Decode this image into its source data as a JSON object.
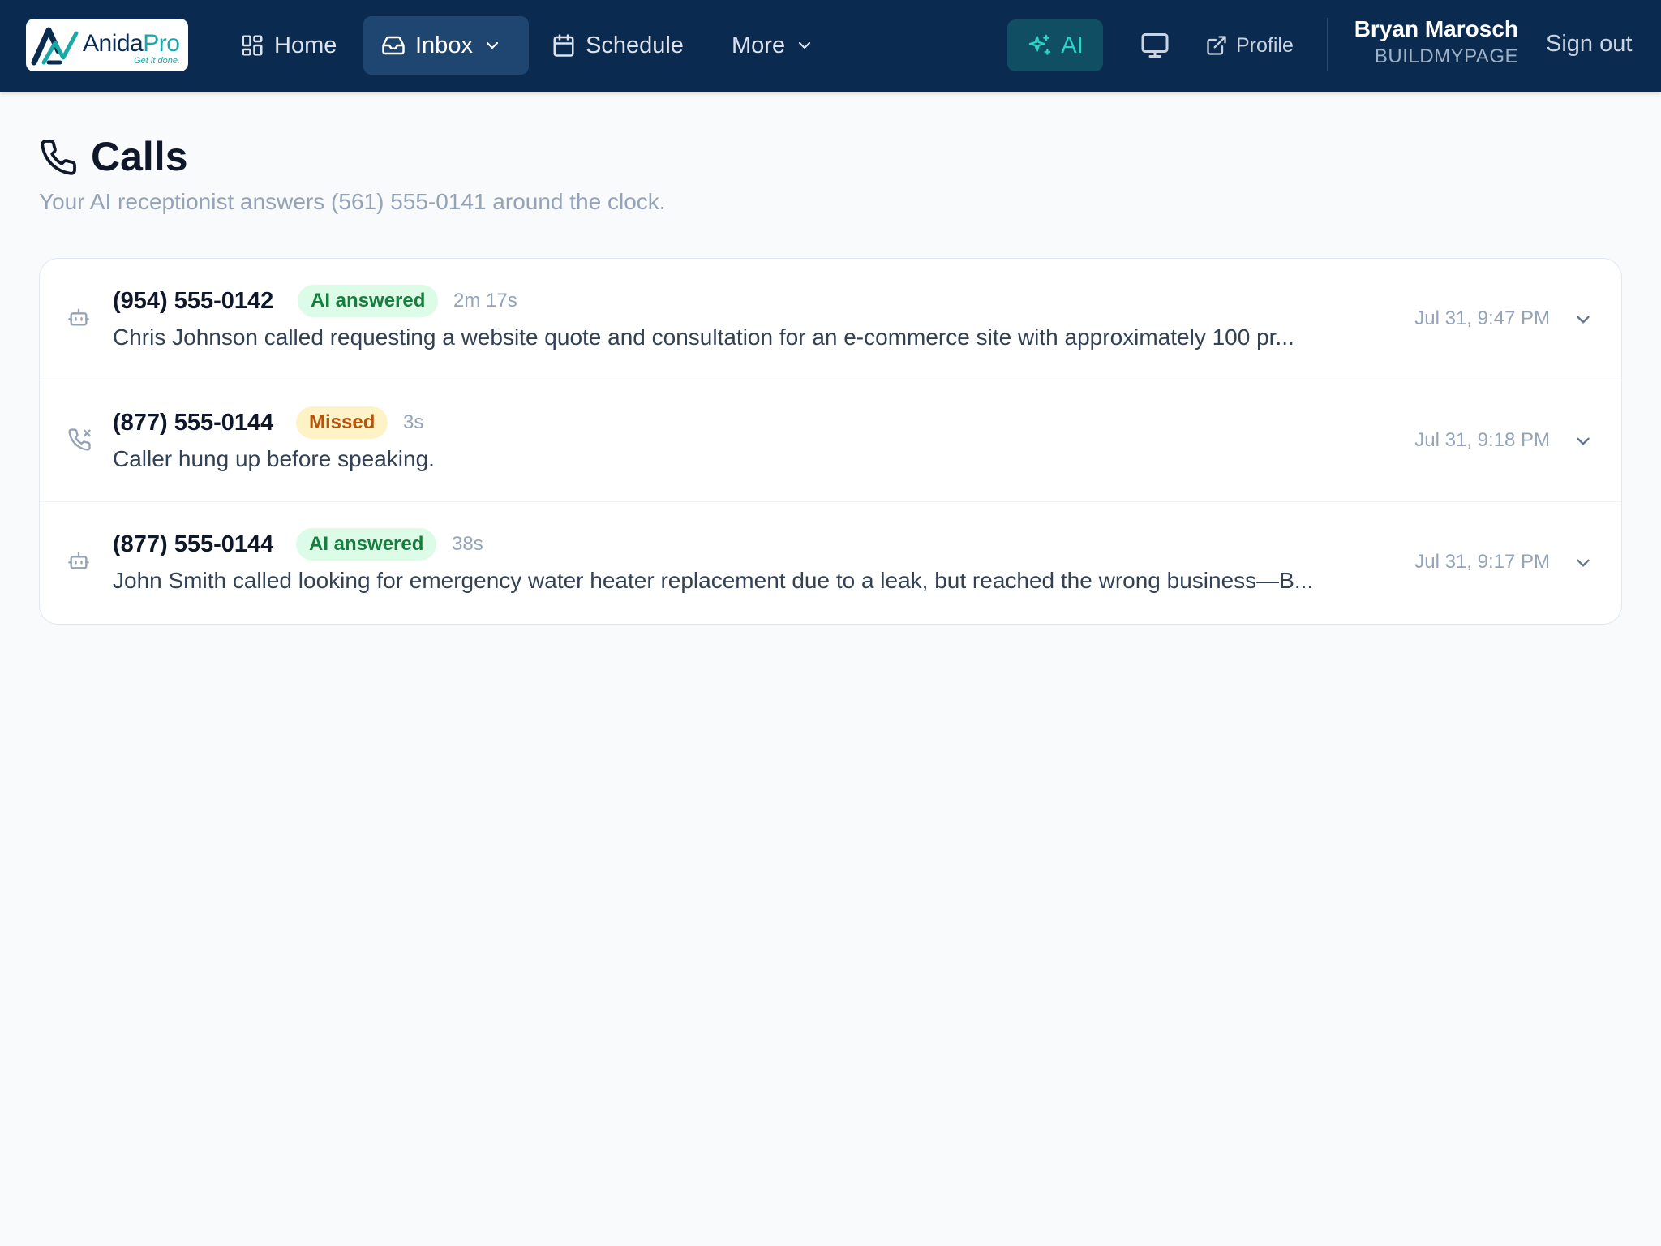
{
  "brand": {
    "name_part1": "Anida",
    "name_part2": "Pro",
    "tagline": "Get it done.",
    "colors": {
      "navy": "#0b2a4f",
      "teal": "#18a8a8"
    }
  },
  "nav": {
    "items": [
      {
        "label": "Home",
        "icon": "grid-icon",
        "active": false
      },
      {
        "label": "Inbox",
        "icon": "inbox-icon",
        "active": true,
        "has_dropdown": true
      },
      {
        "label": "Schedule",
        "icon": "calendar-icon",
        "active": false
      },
      {
        "label": "More",
        "icon": "chevron-down-icon",
        "active": false,
        "has_dropdown": true
      }
    ],
    "ai_label": "AI",
    "ai_icon": "sparkles-icon",
    "monitor_icon": "monitor-icon",
    "profile_label": "Profile",
    "profile_icon": "external-link-icon",
    "user_name": "Bryan Marosch",
    "user_org": "BUILDMYPAGE",
    "signout_label": "Sign out"
  },
  "page": {
    "icon": "phone-icon",
    "title": "Calls",
    "subtitle": "Your AI receptionist answers (561) 555-0141 around the clock."
  },
  "calls": [
    {
      "phone": "(954) 555-0142",
      "status": "AI answered",
      "status_type": "answered",
      "icon": "bot-icon",
      "duration": "2m 17s",
      "summary": "Chris Johnson called requesting a website quote and consultation for an e-commerce site with approximately 100 pr...",
      "time": "Jul 31, 9:47 PM"
    },
    {
      "phone": "(877) 555-0144",
      "status": "Missed",
      "status_type": "missed",
      "icon": "phone-missed-icon",
      "duration": "3s",
      "summary": "Caller hung up before speaking.",
      "time": "Jul 31, 9:18 PM"
    },
    {
      "phone": "(877) 555-0144",
      "status": "AI answered",
      "status_type": "answered",
      "icon": "bot-icon",
      "duration": "38s",
      "summary": "John Smith called looking for emergency water heater replacement due to a leak, but reached the wrong business—B...",
      "time": "Jul 31, 9:17 PM"
    }
  ],
  "status_colors": {
    "answered_bg": "#dcfce7",
    "answered_fg": "#15803d",
    "missed_bg": "#fef3c7",
    "missed_fg": "#b45309"
  }
}
